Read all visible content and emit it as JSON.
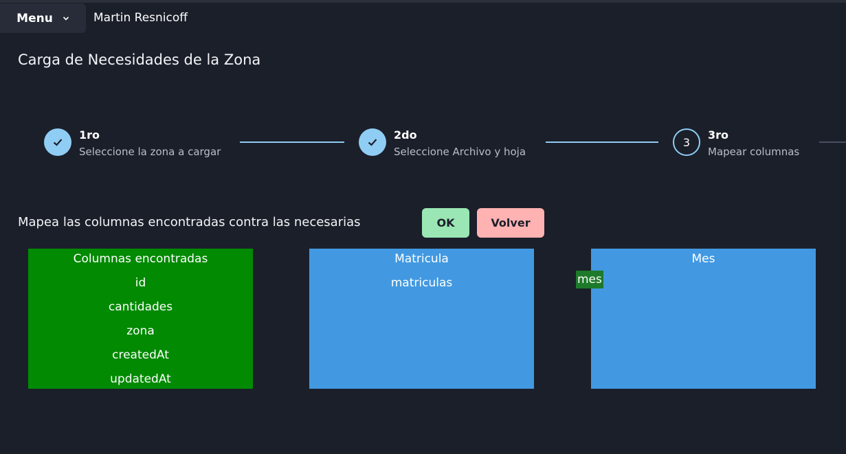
{
  "header": {
    "menu_label": "Menu",
    "user_name": "Martin Resnicoff"
  },
  "page": {
    "title": "Carga de Necesidades de la Zona"
  },
  "stepper": {
    "steps": [
      {
        "title": "1ro",
        "description": "Seleccione la zona a cargar",
        "status": "complete"
      },
      {
        "title": "2do",
        "description": "Seleccione Archivo y hoja",
        "status": "complete"
      },
      {
        "title": "3ro",
        "description": "Mapear columnas",
        "status": "active",
        "number": "3"
      }
    ],
    "accent_color": "#90cdf4"
  },
  "mapping": {
    "instruction": "Mapea las columnas encontradas contra las necesarias",
    "ok_label": "OK",
    "back_label": "Volver",
    "found_columns": {
      "header": "Columnas encontradas",
      "items": [
        "id",
        "cantidades",
        "zona",
        "createdAt",
        "updatedAt"
      ],
      "color": "#028a02"
    },
    "targets": [
      {
        "header": "Matricula",
        "items": [
          "matriculas"
        ],
        "color": "#4299e1"
      },
      {
        "header": "Mes",
        "items": [],
        "color": "#4299e1"
      }
    ],
    "dragging_item": "mes"
  }
}
